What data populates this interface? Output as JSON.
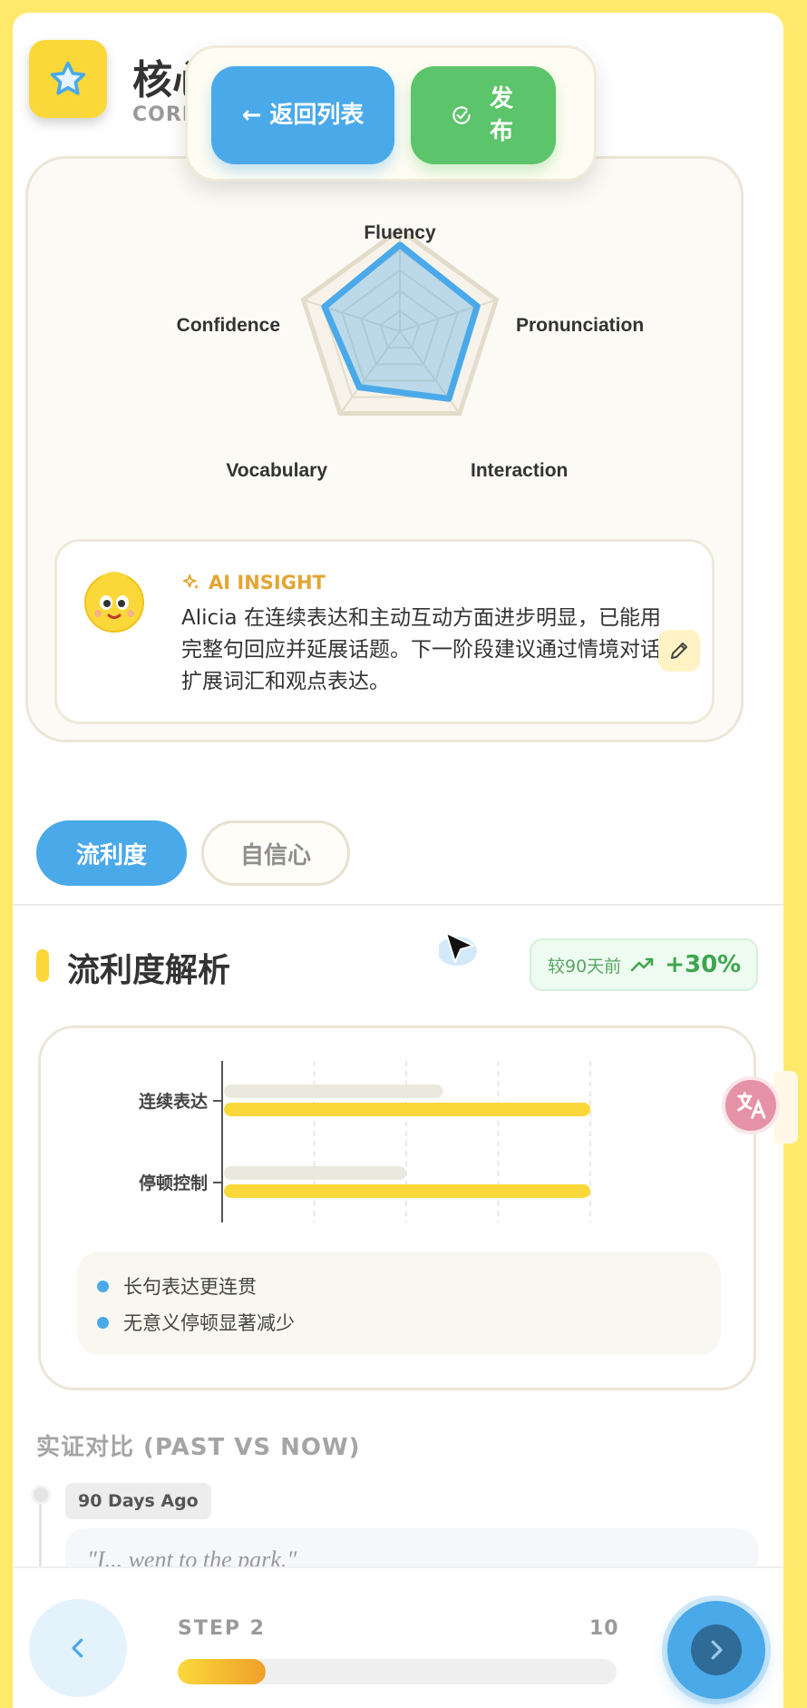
{
  "header": {
    "title": "核心",
    "subtitle": "CORE",
    "star_icon": "star-icon"
  },
  "actions": {
    "back_label": "← 返回列表",
    "publish_label": "发布",
    "publish_icon": "check-circle-icon"
  },
  "radar": {
    "axes": [
      "Fluency",
      "Pronunciation",
      "Interaction",
      "Vocabulary",
      "Confidence"
    ],
    "max": 100,
    "values": [
      85,
      80,
      82,
      68,
      78
    ],
    "color": "#4aa9e9"
  },
  "insight": {
    "label": "AI INSIGHT",
    "text": "Alicia 在连续表达和主动互动方面进步明显，已能用完整句回应并延展话题。下一阶段建议通过情境对话扩展词汇和观点表达。"
  },
  "tabs": [
    {
      "label": "流利度",
      "active": true
    },
    {
      "label": "自信心",
      "active": false
    }
  ],
  "section": {
    "title": "流利度解析",
    "badge_label": "较90天前",
    "badge_value": "+30%"
  },
  "chart_data": {
    "type": "bar",
    "orientation": "horizontal",
    "categories": [
      "连续表达",
      "停顿控制"
    ],
    "series": [
      {
        "values": [
          60,
          50
        ],
        "color": "#ebe8de"
      },
      {
        "values": [
          100,
          100
        ],
        "color": "#fbd83a"
      }
    ],
    "xlim": [
      0,
      100
    ],
    "grid": true,
    "notes": [
      "长句表达更连贯",
      "无意义停顿显著减少"
    ]
  },
  "evidence": {
    "title": "实证对比 (PAST VS NOW)",
    "past_label": "90 Days Ago",
    "past_quote": "\"I... went to the park.\""
  },
  "footer": {
    "step_label": "STEP 2",
    "step_total": "10",
    "progress": 0.2,
    "prev_icon": "chevron-left-icon",
    "next_icon": "chevron-right-icon"
  }
}
